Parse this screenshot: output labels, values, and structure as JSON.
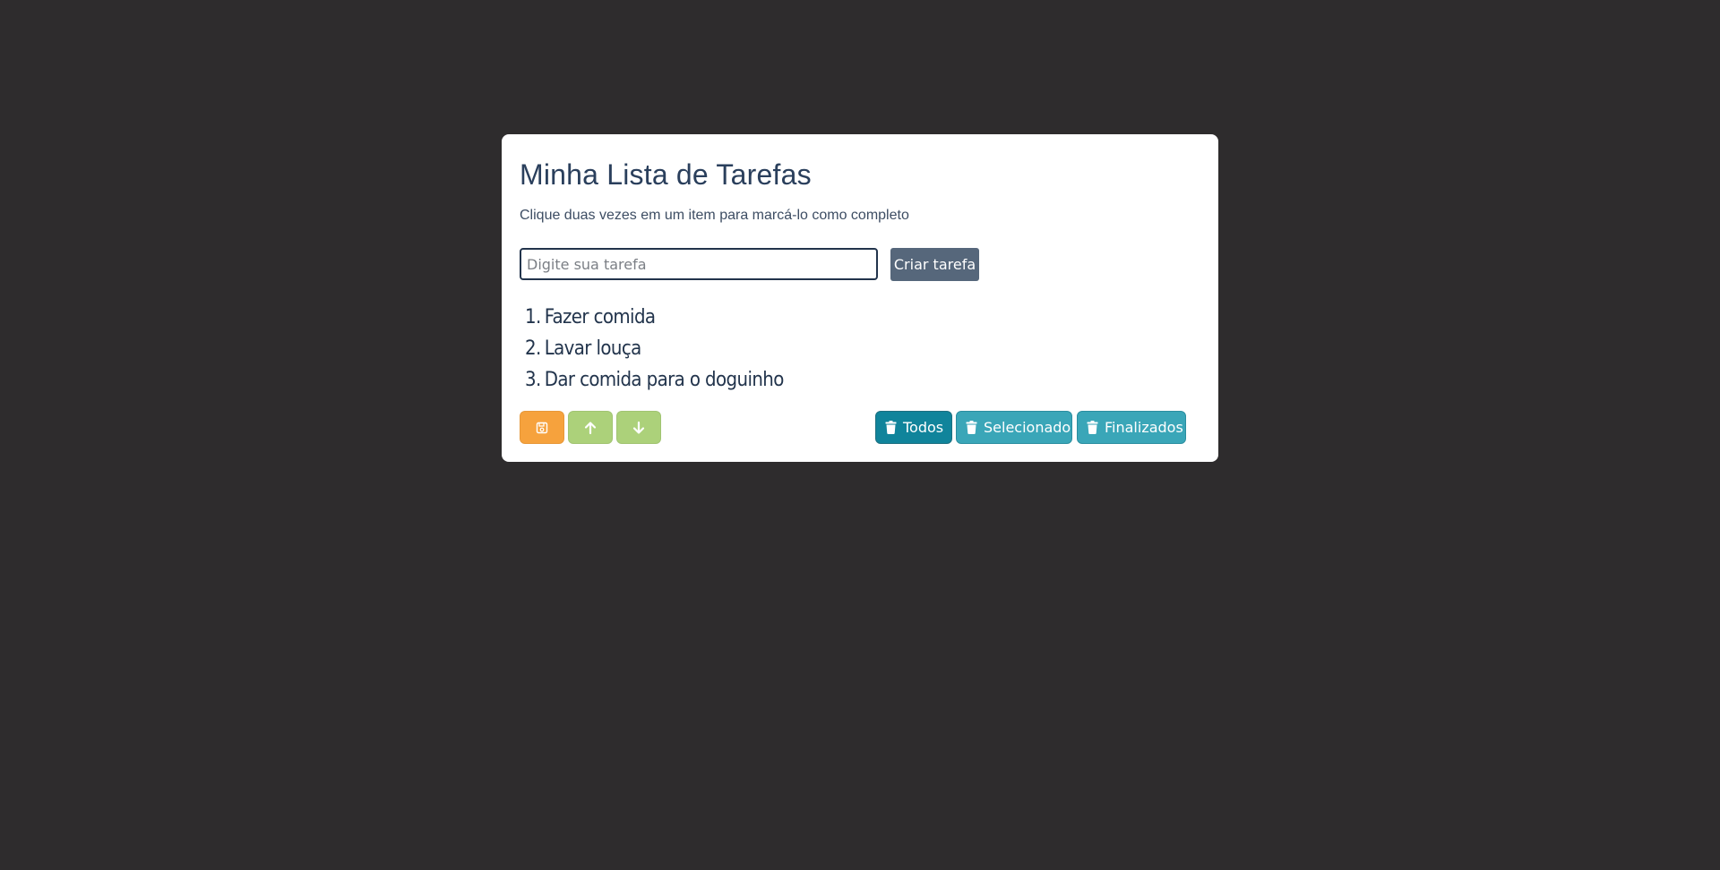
{
  "header": {
    "title": "Minha Lista de Tarefas",
    "subtitle": "Clique duas vezes em um item para marcá-lo como completo"
  },
  "form": {
    "input_value": "",
    "input_placeholder": "Digite sua tarefa",
    "create_label": "Criar tarefa"
  },
  "tasks": [
    {
      "number": "1.",
      "text": "Fazer comida"
    },
    {
      "number": "2.",
      "text": "Lavar louça"
    },
    {
      "number": "3.",
      "text": "Dar comida para o doguinho"
    }
  ],
  "actions": {
    "save_icon": "floppy-disk-icon",
    "up_icon": "arrow-up-icon",
    "down_icon": "arrow-down-icon",
    "delete_icon": "trash-icon",
    "delete_all_label": "Todos",
    "delete_selected_label": "Selecionado",
    "delete_finished_label": "Finalizados"
  },
  "colors": {
    "background": "#2e2c2d",
    "card": "#ffffff",
    "text_primary": "#2a3f5c",
    "create_button": "#56677b",
    "save_button": "#f6a23d",
    "move_buttons": "#acd17a",
    "delete_all_button": "#10849b",
    "delete_buttons": "#3aa6b8"
  }
}
